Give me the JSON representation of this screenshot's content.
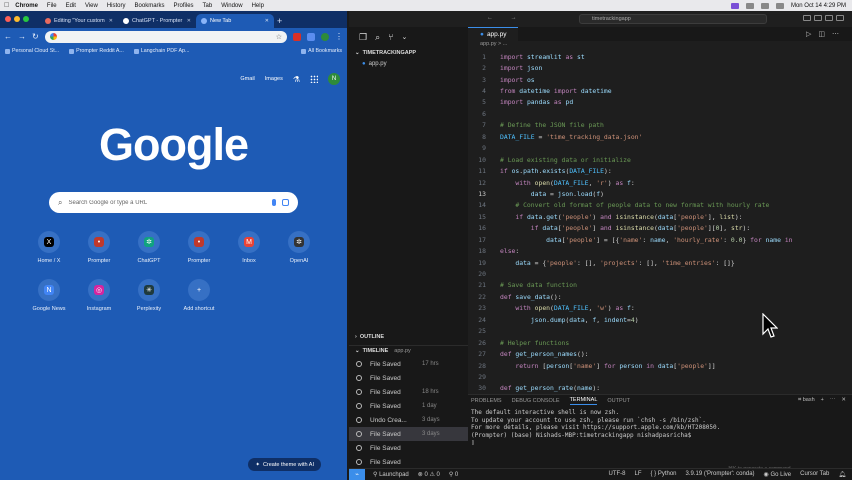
{
  "menubar": {
    "app": "Chrome",
    "items": [
      "File",
      "Edit",
      "View",
      "History",
      "Bookmarks",
      "Profiles",
      "Tab",
      "Window",
      "Help"
    ],
    "clock": "Mon Oct 14  4:29 PM"
  },
  "chrome": {
    "tabs": [
      {
        "label": "Editing \"Your custom",
        "color": "#e86b5f"
      },
      {
        "label": "ChatGPT - Prompter",
        "color": "#ffffff"
      },
      {
        "label": "New Tab",
        "color": "#8ab4f8"
      }
    ],
    "bookmarks": [
      "Personal Cloud St...",
      "Prompter Reddit A...",
      "Langchain PDF Ap..."
    ],
    "all_bookmarks": "All Bookmarks",
    "top_links": [
      "Gmail",
      "Images"
    ],
    "avatar_letter": "N",
    "logo": "Google",
    "search_placeholder": "Search Google or type a URL",
    "shortcuts": [
      {
        "label": "Home / X",
        "glyph": "X",
        "color": "#000000"
      },
      {
        "label": "Prompter",
        "glyph": "•",
        "color": "#c0392b"
      },
      {
        "label": "ChatGPT",
        "glyph": "✲",
        "color": "#10a37f"
      },
      {
        "label": "Prompter",
        "glyph": "•",
        "color": "#c0392b"
      },
      {
        "label": "Inbox",
        "glyph": "M",
        "color": "#ea4335"
      },
      {
        "label": "OpenAI",
        "glyph": "✲",
        "color": "#333333"
      },
      {
        "label": "Google News",
        "glyph": "N",
        "color": "#4285f4"
      },
      {
        "label": "Instagram",
        "glyph": "◎",
        "color": "#d6249f"
      },
      {
        "label": "Perplexity",
        "glyph": "✳",
        "color": "#1f3a3d"
      },
      {
        "label": "Add shortcut",
        "glyph": "+",
        "color": "transparent"
      }
    ],
    "customize_button": "Create theme with AI"
  },
  "vscode": {
    "command_center": "timetrackingapp",
    "explorer_root": "TIMETRACKINGAPP",
    "files": [
      "app.py"
    ],
    "outline_label": "OUTLINE",
    "timeline_label": "TIMELINE",
    "timeline_file": "app.py",
    "timeline": [
      {
        "label": "File Saved",
        "age": "17 hrs"
      },
      {
        "label": "File Saved",
        "age": ""
      },
      {
        "label": "File Saved",
        "age": "18 hrs"
      },
      {
        "label": "File Saved",
        "age": "1 day"
      },
      {
        "label": "Undo Crea...",
        "age": "3 days"
      },
      {
        "label": "File Saved",
        "age": "3 days"
      },
      {
        "label": "File Saved",
        "age": ""
      },
      {
        "label": "File Saved",
        "age": ""
      }
    ],
    "open_tab": "app.py",
    "breadcrumb": "app.py > ...",
    "code": [
      {
        "n": "1",
        "t": "import streamlit as st"
      },
      {
        "n": "2",
        "t": "import json"
      },
      {
        "n": "3",
        "t": "import os"
      },
      {
        "n": "4",
        "t": "from datetime import datetime"
      },
      {
        "n": "5",
        "t": "import pandas as pd"
      },
      {
        "n": "6",
        "t": ""
      },
      {
        "n": "7",
        "t": "# Define the JSON file path"
      },
      {
        "n": "8",
        "t": "DATA_FILE = 'time_tracking_data.json'"
      },
      {
        "n": "9",
        "t": ""
      },
      {
        "n": "10",
        "t": "# Load existing data or initialize"
      },
      {
        "n": "11",
        "t": "if os.path.exists(DATA_FILE):"
      },
      {
        "n": "12",
        "t": "    with open(DATA_FILE, 'r') as f:"
      },
      {
        "n": "13",
        "t": "        data = json.load(f)"
      },
      {
        "n": "14",
        "t": "    # Convert old format of people data to new format with hourly rate"
      },
      {
        "n": "15",
        "t": "    if data.get('people') and isinstance(data['people'], list):"
      },
      {
        "n": "16",
        "t": "        if data['people'] and isinstance(data['people'][0], str):"
      },
      {
        "n": "17",
        "t": "            data['people'] = [{'name': name, 'hourly_rate': 0.0} for name in"
      },
      {
        "n": "18",
        "t": "else:"
      },
      {
        "n": "19",
        "t": "    data = {'people': [], 'projects': [], 'time_entries': []}"
      },
      {
        "n": "20",
        "t": ""
      },
      {
        "n": "21",
        "t": "# Save data function"
      },
      {
        "n": "22",
        "t": "def save_data():"
      },
      {
        "n": "23",
        "t": "    with open(DATA_FILE, 'w') as f:"
      },
      {
        "n": "24",
        "t": "        json.dump(data, f, indent=4)"
      },
      {
        "n": "25",
        "t": ""
      },
      {
        "n": "26",
        "t": "# Helper functions"
      },
      {
        "n": "27",
        "t": "def get_person_names():"
      },
      {
        "n": "28",
        "t": "    return [person['name'] for person in data['people']]"
      },
      {
        "n": "29",
        "t": ""
      },
      {
        "n": "30",
        "t": "def get_person_rate(name):"
      }
    ],
    "current_line": "13",
    "panel_tabs": [
      "PROBLEMS",
      "DEBUG CONSOLE",
      "TERMINAL",
      "OUTPUT"
    ],
    "active_panel_tab": "TERMINAL",
    "shell": "bash",
    "terminal": [
      "The default interactive shell is now zsh.",
      "To update your account to use zsh, please run `chsh -s /bin/zsh`.",
      "For more details, please visit https://support.apple.com/kb/HT208050.",
      "(Prompter) (base) Nishads-MBP:timetrackingapp nishadpasricha$ "
    ],
    "panel_hint": "⌘K to generate a command",
    "status": {
      "launchpad": "Launchpad",
      "problems": "⊗ 0  ⚠ 0",
      "ports": "⚲ 0",
      "encoding": "UTF-8",
      "eol": "LF",
      "language": "Python",
      "interpreter": "3.9.19 ('Prompter': conda)",
      "golive": "Go Live",
      "cursortab": "Cursor Tab"
    }
  },
  "colors": {
    "chrome_bg": "#1e5bb5",
    "vscode_bg": "#1e1e1e",
    "accent": "#3b8eea"
  }
}
